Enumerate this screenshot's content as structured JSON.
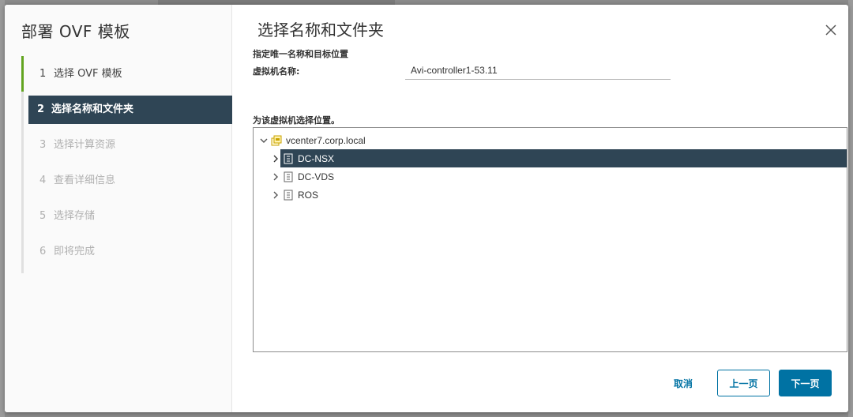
{
  "wizard": {
    "title": "部署 OVF 模板",
    "steps": [
      {
        "num": "1",
        "label": "选择 OVF 模板",
        "state": "done"
      },
      {
        "num": "2",
        "label": "选择名称和文件夹",
        "state": "active"
      },
      {
        "num": "3",
        "label": "选择计算资源",
        "state": "pending"
      },
      {
        "num": "4",
        "label": "查看详细信息",
        "state": "pending"
      },
      {
        "num": "5",
        "label": "选择存储",
        "state": "pending"
      },
      {
        "num": "6",
        "label": "即将完成",
        "state": "pending"
      }
    ]
  },
  "page": {
    "title": "选择名称和文件夹",
    "close_icon": "close-icon",
    "name_section_label": "指定唯一名称和目标位置",
    "vm_name_label": "虚拟机名称:",
    "vm_name_value": "Avi-controller1-53.11",
    "location_label": "为该虚拟机选择位置。"
  },
  "tree": {
    "root": {
      "label": "vcenter7.corp.local",
      "icon": "vcenter-icon",
      "expanded": true
    },
    "children": [
      {
        "label": "DC-NSX",
        "icon": "datacenter-icon",
        "selected": true
      },
      {
        "label": "DC-VDS",
        "icon": "datacenter-icon",
        "selected": false
      },
      {
        "label": "ROS",
        "icon": "datacenter-icon",
        "selected": false
      }
    ]
  },
  "footer": {
    "cancel_label": "取消",
    "prev_label": "上一页",
    "next_label": "下一页"
  },
  "colors": {
    "accent": "#0072a3",
    "selected_bg": "#2f4555",
    "done_marker": "#62a420"
  }
}
